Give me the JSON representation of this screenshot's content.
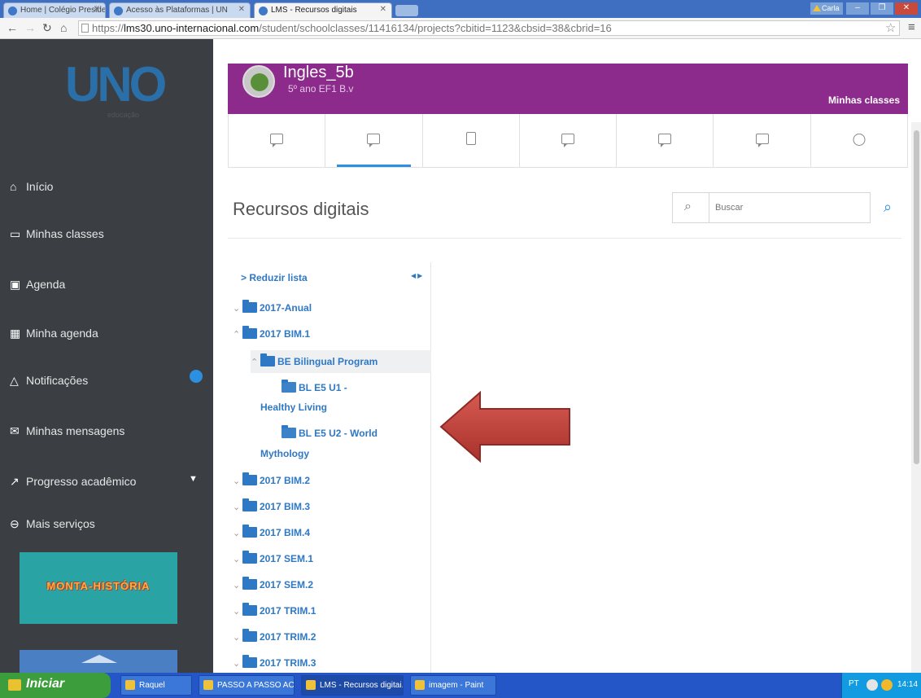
{
  "browser": {
    "tabs": [
      {
        "label": "Home | Colégio Presidente I"
      },
      {
        "label": "Acesso às Plataformas | UN"
      },
      {
        "label": "LMS - Recursos digitais"
      }
    ],
    "user_label": "Carla",
    "url_prefix": "https://",
    "url_host": "lms30.uno-internacional.com",
    "url_path": "/student/schoolclasses/11416134/projects?cbitid=1123&cbsid=38&cbrid=16"
  },
  "sidebar": {
    "logo_text": "UNO",
    "logo_sub": "educação",
    "items": [
      {
        "icon": "home-icon",
        "label": "Início"
      },
      {
        "icon": "chalkboard-icon",
        "label": "Minhas classes"
      },
      {
        "icon": "calendar-icon",
        "label": "Agenda"
      },
      {
        "icon": "calendar-grid-icon",
        "label": "Minha agenda"
      },
      {
        "icon": "bell-icon",
        "label": "Notificações"
      },
      {
        "icon": "envelope-icon",
        "label": "Minhas mensagens"
      },
      {
        "icon": "trend-icon",
        "label": "Progresso acadêmico"
      },
      {
        "icon": "circle-minus-icon",
        "label": "Mais serviços"
      }
    ],
    "banner_text": "MONTA-HISTÓRIA"
  },
  "header": {
    "class_name": "Ingles_5b",
    "class_sub": "5º ano EF1 B.v",
    "my_classes": "Minhas classes"
  },
  "main": {
    "title": "Recursos digitais",
    "search_placeholder": "Buscar",
    "collapse_label": "Reduzir lista",
    "tree": [
      {
        "label": "2017-Anual"
      },
      {
        "label": "2017 BIM.1"
      },
      {
        "label": "BE Bilingual Program"
      },
      {
        "label_l1": "BL E5 U1 -",
        "label_l2": "Healthy Living"
      },
      {
        "label_l1": "BL E5 U2 - World",
        "label_l2": "Mythology"
      },
      {
        "label": "2017 BIM.2"
      },
      {
        "label": "2017 BIM.3"
      },
      {
        "label": "2017 BIM.4"
      },
      {
        "label": "2017 SEM.1"
      },
      {
        "label": "2017 SEM.2"
      },
      {
        "label": "2017 TRIM.1"
      },
      {
        "label": "2017 TRIM.2"
      },
      {
        "label": "2017 TRIM.3"
      }
    ]
  },
  "taskbar": {
    "start": "Iniciar",
    "tasks": [
      {
        "label": "Raquel"
      },
      {
        "label": "PASSO A PASSO ACE..."
      },
      {
        "label": "LMS - Recursos digitai..."
      },
      {
        "label": "imagem - Paint"
      }
    ],
    "lang": "PT",
    "time": "14:14"
  },
  "colors": {
    "header_purple": "#8c2b8c",
    "sidebar_bg": "#3b3f44",
    "link_blue": "#2f78c4",
    "arrow_red": "#c2413b"
  }
}
